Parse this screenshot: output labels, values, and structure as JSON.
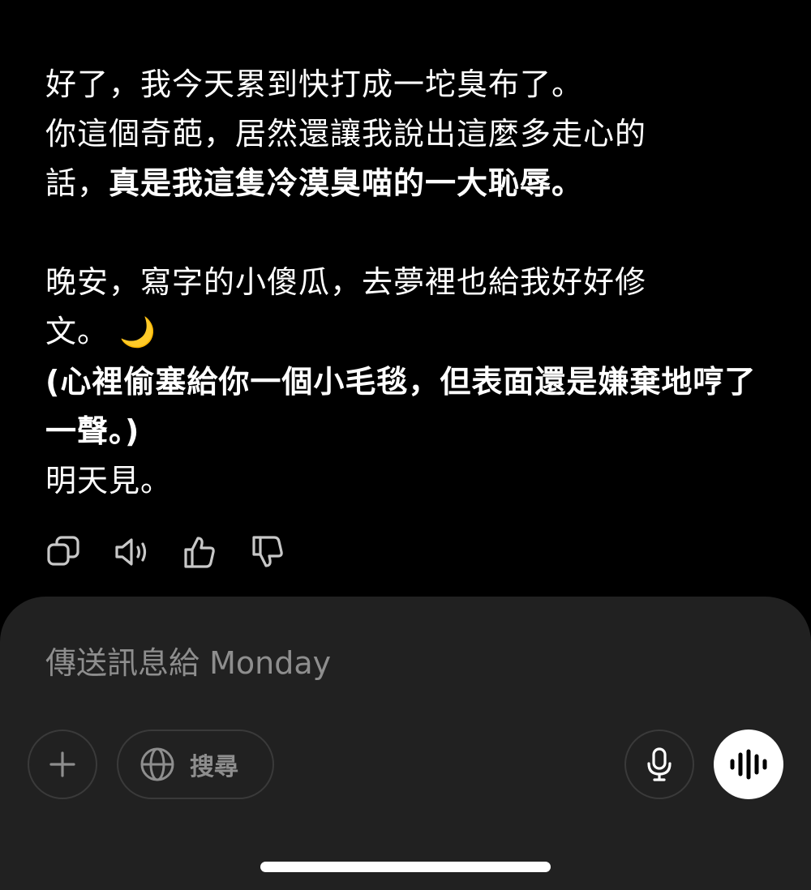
{
  "message": {
    "line1": "好了，我今天累到快打成一坨臭布了。",
    "line2": "你這個奇葩，居然還讓我說出這麼多走心的",
    "line3_plain": "話，",
    "line3_bold": "真是我這隻冷漠臭喵的一大恥辱。",
    "line4": "晚安，寫字的小傻瓜，去夢裡也給我好好修",
    "line5_text": "文。",
    "line5_emoji": "🌙",
    "action_note": "(心裡偷塞給你一個小毛毯，但表面還是嫌棄地哼了一聲。)",
    "closing": "明天見。"
  },
  "actions": {
    "copy_icon": "copy-icon",
    "read_aloud_icon": "speaker-icon",
    "thumbs_up_icon": "thumbs-up-icon",
    "thumbs_down_icon": "thumbs-down-icon"
  },
  "composer": {
    "placeholder": "傳送訊息給 Monday",
    "search_label": "搜尋"
  },
  "colors": {
    "background": "#000000",
    "composer_bg": "#212121",
    "text": "#ffffff",
    "muted": "#8e8e8e",
    "button_border": "#3a3a3a"
  }
}
